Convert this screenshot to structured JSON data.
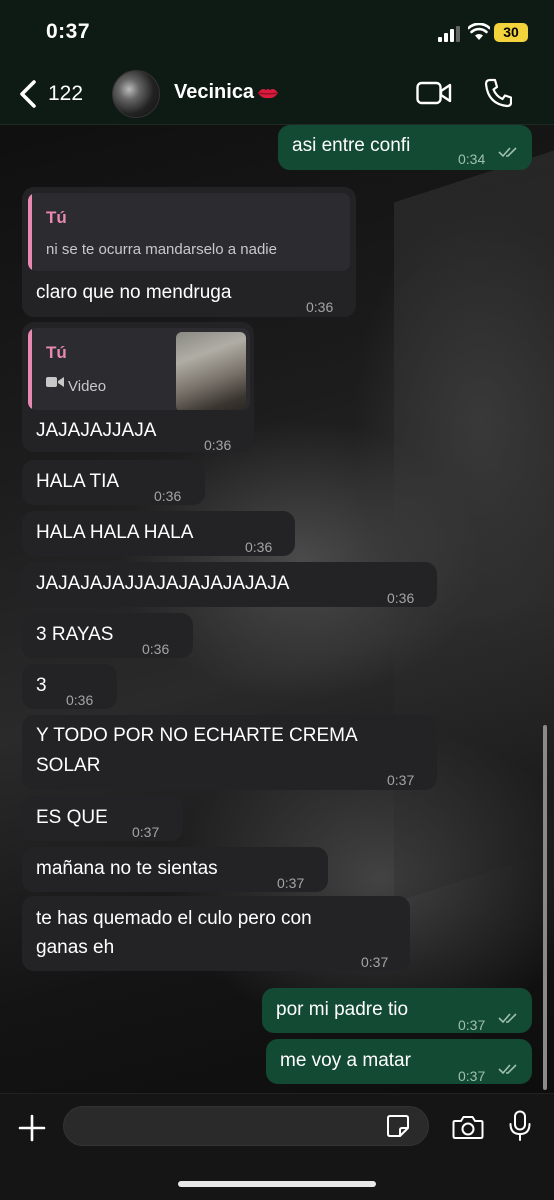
{
  "status": {
    "time": "0:37",
    "battery": "30"
  },
  "header": {
    "back_count": "122",
    "contact_name": "Vecinica"
  },
  "messages": [
    {
      "text": "asi entre confi",
      "time": "0:34"
    },
    {
      "quote_name": "Tú",
      "quote_text": "ni se te ocurra mandarselo a nadie",
      "text": "claro que no mendruga",
      "time": "0:36"
    },
    {
      "quote_name": "Tú",
      "quote_text": "Video",
      "text": "JAJAJAJJAJA",
      "time": "0:36"
    },
    {
      "text": "HALA TIA",
      "time": "0:36"
    },
    {
      "text": "HALA HALA HALA",
      "time": "0:36"
    },
    {
      "text": "JAJAJAJAJJAJAJAJAJAJAJA",
      "time": "0:36"
    },
    {
      "text": "3 RAYAS",
      "time": "0:36"
    },
    {
      "text": "3",
      "time": "0:36"
    },
    {
      "line1": "Y TODO POR NO ECHARTE CREMA",
      "line2": "SOLAR",
      "time": "0:37"
    },
    {
      "text": "ES QUE",
      "time": "0:37"
    },
    {
      "text": "mañana no te sientas",
      "time": "0:37"
    },
    {
      "line1": "te has quemado el culo pero con",
      "line2": "ganas eh",
      "time": "0:37"
    },
    {
      "text": "por mi padre tio",
      "time": "0:37"
    },
    {
      "text": "me voy a matar",
      "time": "0:37"
    }
  ],
  "composer": {
    "value": ""
  },
  "icons": {
    "back": "chevron-left-icon",
    "video_call": "video-camera-icon",
    "call": "phone-icon",
    "attach": "plus-icon",
    "sticker": "sticker-icon",
    "camera": "camera-icon",
    "mic": "microphone-icon",
    "read": "double-check-icon",
    "lips": "kiss-lips-emoji"
  },
  "colors": {
    "outgoing": "#134a33",
    "incoming": "#232326",
    "quote_accent": "#e889b4",
    "header": "#0e1a14"
  }
}
